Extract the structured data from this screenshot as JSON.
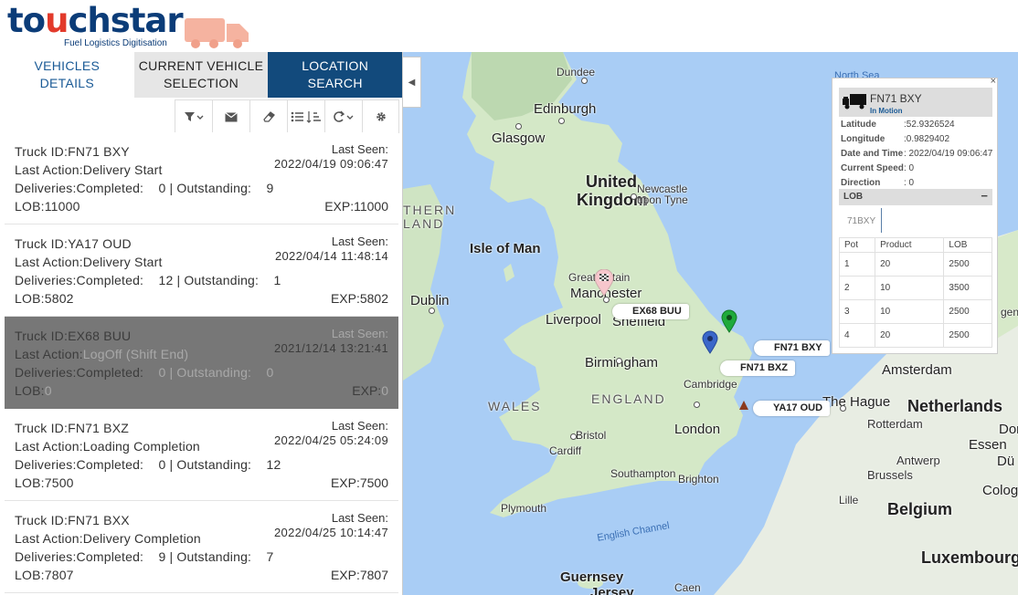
{
  "brand": {
    "logo_left": "to",
    "logo_red": "u",
    "logo_right": "chstar",
    "tagline": "Fuel Logistics Digitisation"
  },
  "tabs": [
    {
      "label": "VEHICLES\nDETAILS"
    },
    {
      "label": "CURRENT VEHICLE\nSELECTION"
    },
    {
      "label": "LOCATION\nSEARCH"
    }
  ],
  "toolbar": {
    "filter_icon": "filter-icon",
    "mail_icon": "envelope-icon",
    "eraser_icon": "eraser-icon",
    "list_icon": "list-sort-icon",
    "refresh_icon": "refresh-icon",
    "settings_icon": "gear-icon"
  },
  "labels": {
    "truck_id": "Truck ID:",
    "last_action": "Last Action:",
    "deliveries": "Deliveries:Completed:",
    "outstanding": "Outstanding:",
    "lob": "LOB:",
    "exp": "EXP:",
    "last_seen": "Last Seen:"
  },
  "vehicles": [
    {
      "id": "FN71 BXY",
      "last_seen": "2022/04/19 09:06:47",
      "action": "Delivery Start",
      "completed": "0",
      "outstanding": "9",
      "lob": "11000",
      "exp": "11000"
    },
    {
      "id": "YA17 OUD",
      "last_seen": "2022/04/14 11:48:14",
      "action": "Delivery Start",
      "completed": "12",
      "outstanding": "1",
      "lob": "5802",
      "exp": "5802"
    },
    {
      "id": "EX68 BUU",
      "last_seen": "2021/12/14 13:21:41",
      "action": "LogOff (Shift End)",
      "completed": "0",
      "outstanding": "0",
      "lob": "0",
      "exp": "0"
    },
    {
      "id": "FN71 BXZ",
      "last_seen": "2022/04/25 05:24:09",
      "action": "Loading Completion",
      "completed": "0",
      "outstanding": "12",
      "lob": "7500",
      "exp": "7500"
    },
    {
      "id": "FN71 BXX",
      "last_seen": "2022/04/25 10:14:47",
      "action": "Delivery Completion",
      "completed": "9",
      "outstanding": "7",
      "lob": "7807",
      "exp": "7807"
    }
  ],
  "map": {
    "places": {
      "north_sea": "North Sea",
      "dundee": "Dundee",
      "edinburgh": "Edinburgh",
      "glasgow": "Glasgow",
      "united": "United",
      "kingdom": "Kingdom",
      "newcastle1": "Newcastle",
      "newcastle2": "upon Tyne",
      "thern": "THERN",
      "land": "LAND",
      "isle_of_man": "Isle of Man",
      "dublin": "Dublin",
      "great_britain": "Great Britain",
      "manchester": "Manchester",
      "liverpool": "Liverpool",
      "sheffield": "Sheffield",
      "birmingham": "Birmingham",
      "wales": "WALES",
      "england": "ENGLAND",
      "cambridge": "Cambridge",
      "bristol": "Bristol",
      "cardiff": "Cardiff",
      "london": "London",
      "southampton": "Southampton",
      "brighton": "Brighton",
      "plymouth": "Plymouth",
      "english_channel": "English Channel",
      "guernsey": "Guernsey",
      "jersey": "Jersey",
      "caen": "Caen",
      "amsterdam": "Amsterdam",
      "the_hague": "The Hague",
      "netherlands": "Netherlands",
      "rotterdam": "Rotterdam",
      "essen": "Essen",
      "antwerp": "Antwerp",
      "brussels": "Brussels",
      "lille": "Lille",
      "belgium": "Belgium",
      "luxembourg": "Luxembourg",
      "cologne": "Colog",
      "du": "Dü",
      "dor": "Dor",
      "gen": "gen"
    },
    "truck_labels": {
      "ex68": "EX68 BUU",
      "fn71bxy": "FN71 BXY",
      "fn71bxz": "FN71 BXZ",
      "ya17": "YA17 OUD"
    },
    "marker_colors": {
      "green": "#1faa3c",
      "blue": "#3a67c9",
      "pink": "#f7c6cc",
      "triangle": "#8b3a1e"
    }
  },
  "popup": {
    "title": "FN71 BXY",
    "status": "In Motion",
    "rows": [
      {
        "k": "Latitude",
        "v": ":52.9326524"
      },
      {
        "k": "Longitude",
        "v": ":0.9829402"
      },
      {
        "k": "Date and Time",
        "v": ": 2022/04/19 09:06:47"
      },
      {
        "k": "Current Speed",
        "v": ": 0"
      },
      {
        "k": "Direction",
        "v": ": 0"
      }
    ],
    "lob_header": "LOB",
    "lob_minus": "−",
    "lob_id": "71BXY",
    "close": "×",
    "table_head": [
      "Pot",
      "Product",
      "LOB"
    ],
    "table_rows": [
      [
        "1",
        "20",
        "2500"
      ],
      [
        "2",
        "10",
        "3500"
      ],
      [
        "3",
        "10",
        "2500"
      ],
      [
        "4",
        "20",
        "2500"
      ]
    ]
  }
}
